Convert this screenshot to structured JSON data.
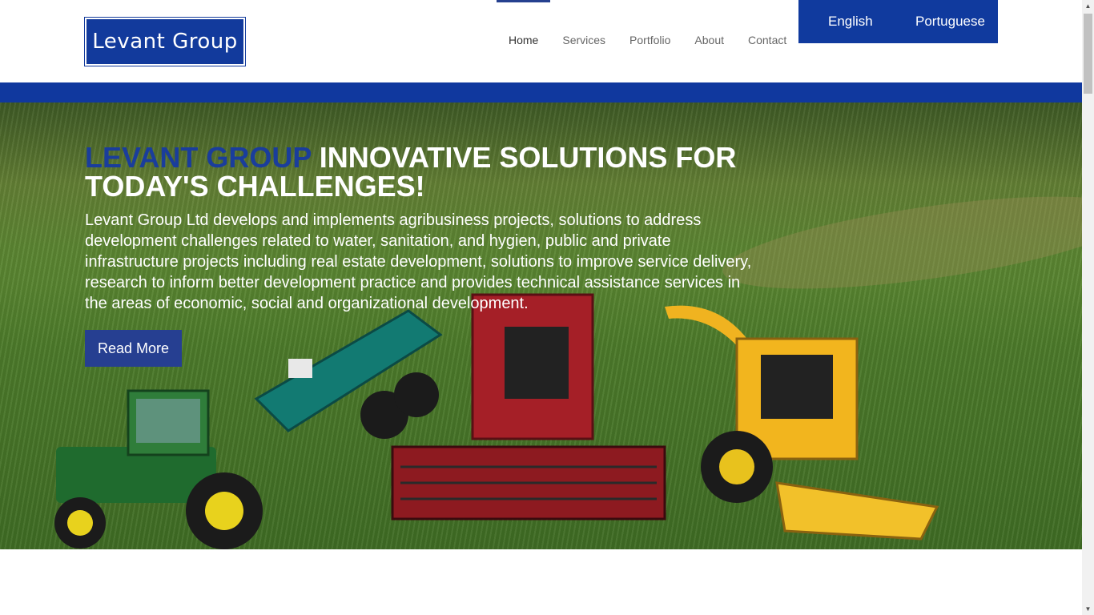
{
  "header": {
    "logo_text": "Levant Group",
    "nav": [
      {
        "label": "Home",
        "active": true
      },
      {
        "label": "Services"
      },
      {
        "label": "Portfolio"
      },
      {
        "label": "About"
      },
      {
        "label": "Contact"
      }
    ],
    "languages": [
      "English",
      "Portuguese"
    ]
  },
  "hero": {
    "title_brand": "LEVANT GROUP",
    "title_rest": " INNOVATIVE SOLUTIONS FOR TODAY'S CHALLENGES!",
    "text": "Levant Group Ltd develops and implements agribusiness projects, solutions to address development challenges related to water, sanitation, and hygien, public and private infrastructure projects including real estate development, solutions to improve service delivery, research to inform better development practice and provides technical assistance services in the areas of economic, social and organizational development.",
    "button_label": "Read More",
    "image_icons": [
      "tractor-icon",
      "tanker-icon",
      "combine-icon",
      "harvester-icon"
    ]
  },
  "colors": {
    "brand_blue": "#103a9e",
    "button_blue": "#263f91"
  }
}
